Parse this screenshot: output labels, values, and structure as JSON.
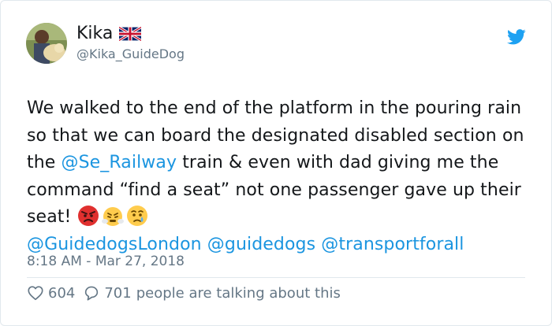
{
  "user": {
    "display_name": "Kika",
    "handle": "@Kika_GuideDog"
  },
  "tweet": {
    "text_part1": "We walked to the end of the platform in the pouring rain so that we can board the designated disabled section on the ",
    "mention_railway": "@Se_Railway",
    "text_part2": " train & even with dad giving me the command “find a seat” not one passenger gave up their seat! ",
    "mention_guidedogs_london": "@GuidedogsLondon",
    "mention_guidedogs": "@guidedogs",
    "mention_transport": "@transportforall",
    "timestamp": "8:18 AM - Mar 27, 2018"
  },
  "stats": {
    "likes": "604",
    "replies": "701",
    "talking_label": "people are talking about this"
  },
  "icons": {
    "avatar": "avatar-icon",
    "flag": "uk-flag-icon",
    "twitter": "twitter-bird-icon",
    "emoji1": "angry-face-icon",
    "emoji2": "steam-face-icon",
    "emoji3": "crying-face-icon",
    "like": "heart-icon",
    "reply": "speech-bubble-icon"
  },
  "colors": {
    "link": "#1b95e0",
    "muted": "#657786",
    "text": "#14171a",
    "twitter_blue": "#1da1f2"
  }
}
